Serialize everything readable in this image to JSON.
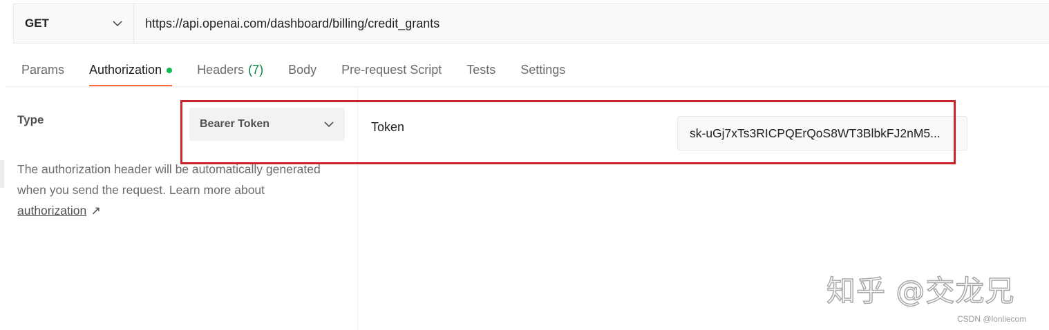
{
  "request": {
    "method": "GET",
    "url": "https://api.openai.com/dashboard/billing/credit_grants"
  },
  "tabs": [
    {
      "label": "Params"
    },
    {
      "label": "Authorization",
      "active": true,
      "indicator": "green-dot"
    },
    {
      "label": "Headers",
      "count": "(7)"
    },
    {
      "label": "Body"
    },
    {
      "label": "Pre-request Script"
    },
    {
      "label": "Tests"
    },
    {
      "label": "Settings"
    }
  ],
  "auth": {
    "type_label": "Type",
    "type_value": "Bearer Token",
    "help_text": "The authorization header will be automatically generated when you send the request. Learn more about ",
    "help_link": "authorization",
    "help_arrow": "↗",
    "token_label": "Token",
    "token_value": "sk-uGj7xTs3RICPQErQoS8WT3BlbkFJ2nM5..."
  },
  "watermark": {
    "zhihu": "知乎 @交龙兄",
    "csdn": "CSDN @lonliecom"
  },
  "colors": {
    "active_tab_underline": "#ff6c37",
    "status_dot": "#0cbb52",
    "header_count": "#0a8544",
    "annotation_box": "#cc2229"
  },
  "icons": {
    "method_dropdown": "chevron-down-icon",
    "auth_dropdown": "chevron-down-icon",
    "external_link": "arrow-up-right-icon"
  }
}
